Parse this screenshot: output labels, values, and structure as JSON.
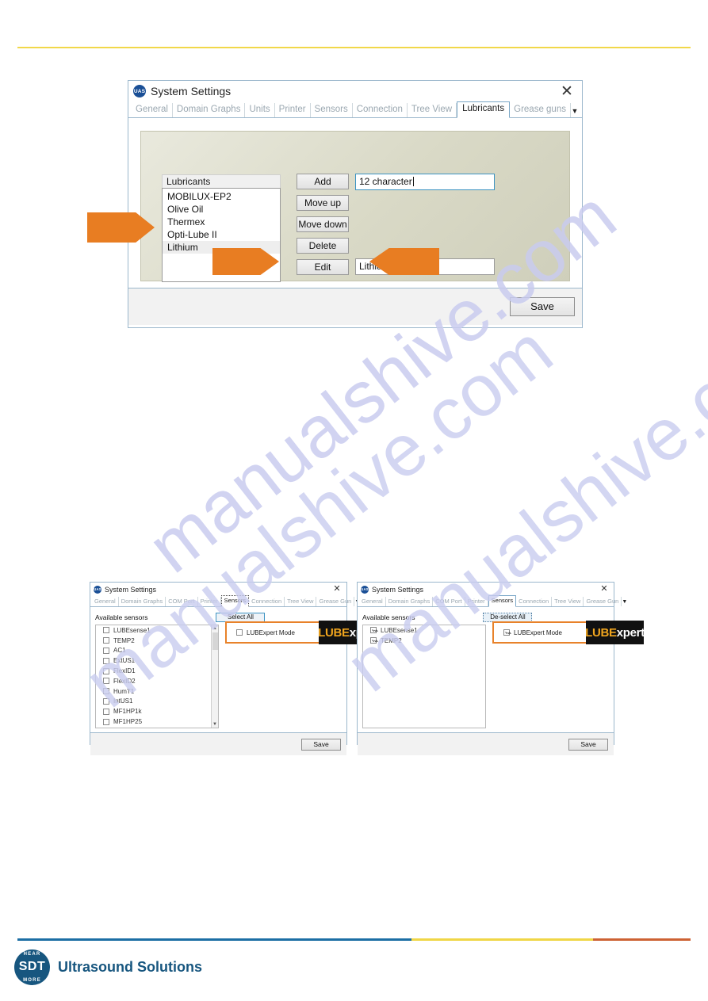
{
  "page": {
    "rules": {
      "top_color": "#f1d84a",
      "footer_blue": "#1c6ea4",
      "footer_yellow": "#f0d646",
      "footer_orange": "#cd6234"
    },
    "watermark_text": "manualshive.com"
  },
  "lubricants_dialog": {
    "title": "System Settings",
    "icon": "uas-logo-icon",
    "icon_text": "UAS",
    "close_label": "✕",
    "tabs": [
      {
        "label": "General",
        "active": false
      },
      {
        "label": "Domain Graphs",
        "active": false
      },
      {
        "label": "Units",
        "active": false
      },
      {
        "label": "Printer",
        "active": false
      },
      {
        "label": "Sensors",
        "active": false
      },
      {
        "label": "Connection",
        "active": false
      },
      {
        "label": "Tree View",
        "active": false
      },
      {
        "label": "Lubricants",
        "active": true
      },
      {
        "label": "Grease guns",
        "active": false
      }
    ],
    "tab_overflow": "▼",
    "list_header": "Lubricants",
    "list_items": [
      {
        "label": "MOBILUX-EP2",
        "selected": false
      },
      {
        "label": "Olive Oil",
        "selected": false
      },
      {
        "label": "Thermex",
        "selected": false
      },
      {
        "label": "Opti-Lube II",
        "selected": false
      },
      {
        "label": "Lithium",
        "selected": true
      }
    ],
    "buttons": {
      "add": "Add",
      "move_up": "Move up",
      "move_down": "Move down",
      "delete": "Delete",
      "edit": "Edit"
    },
    "add_input_value": "12 character",
    "edit_input_value": "Lithium",
    "save_label": "Save",
    "annotation_color": "#e87d22"
  },
  "sensors_left": {
    "title": "System Settings",
    "icon_text": "UAS",
    "close_label": "✕",
    "tabs": [
      {
        "label": "General",
        "active": false
      },
      {
        "label": "Domain Graphs",
        "active": false
      },
      {
        "label": "COM Port",
        "active": false
      },
      {
        "label": "Printer",
        "active": false
      },
      {
        "label": "Sensors",
        "active": true
      },
      {
        "label": "Connection",
        "active": false
      },
      {
        "label": "Tree View",
        "active": false
      },
      {
        "label": "Grease Gun",
        "active": false
      }
    ],
    "tab_overflow": "▼",
    "available_label": "Available sensors",
    "select_all_label": "Select All",
    "sensors": [
      {
        "label": "LUBEsense1",
        "checked": false
      },
      {
        "label": "TEMP2",
        "checked": false
      },
      {
        "label": "AC1",
        "checked": false
      },
      {
        "label": "ExtUS1",
        "checked": false
      },
      {
        "label": "FlexID1",
        "checked": false
      },
      {
        "label": "FlexID2",
        "checked": false
      },
      {
        "label": "HumT1",
        "checked": false
      },
      {
        "label": "IntUS1",
        "checked": false
      },
      {
        "label": "MF1HP1k",
        "checked": false
      },
      {
        "label": "MF1HP25",
        "checked": false
      }
    ],
    "lubexpert_mode_label": "LUBExpert Mode",
    "lubexpert_mode_checked": false,
    "logo_part1": "LUBE",
    "logo_part2": "xpert",
    "save_label": "Save",
    "scroll_up": "▲",
    "scroll_down": "▼"
  },
  "sensors_right": {
    "title": "System Settings",
    "icon_text": "UAS",
    "close_label": "✕",
    "tabs": [
      {
        "label": "General",
        "active": false
      },
      {
        "label": "Domain Graphs",
        "active": false
      },
      {
        "label": "COM Port",
        "active": false
      },
      {
        "label": "Printer",
        "active": false
      },
      {
        "label": "Sensors",
        "active": true
      },
      {
        "label": "Connection",
        "active": false
      },
      {
        "label": "Tree View",
        "active": false
      },
      {
        "label": "Grease Gun",
        "active": false
      }
    ],
    "tab_overflow": "▼",
    "available_label": "Available sensors",
    "select_all_label": "De-select All",
    "sensors": [
      {
        "label": "LUBEsense1",
        "checked": true
      },
      {
        "label": "TEMP2",
        "checked": true
      }
    ],
    "lubexpert_mode_label": "LUBExpert Mode",
    "lubexpert_mode_checked": true,
    "logo_part1": "LUBE",
    "logo_part2": "xpert",
    "save_label": "Save"
  },
  "footer": {
    "logo_main": "SDT",
    "logo_top": "HEAR",
    "logo_bottom": "MORE",
    "tagline": "Ultrasound Solutions",
    "brand_color": "#17567f"
  }
}
